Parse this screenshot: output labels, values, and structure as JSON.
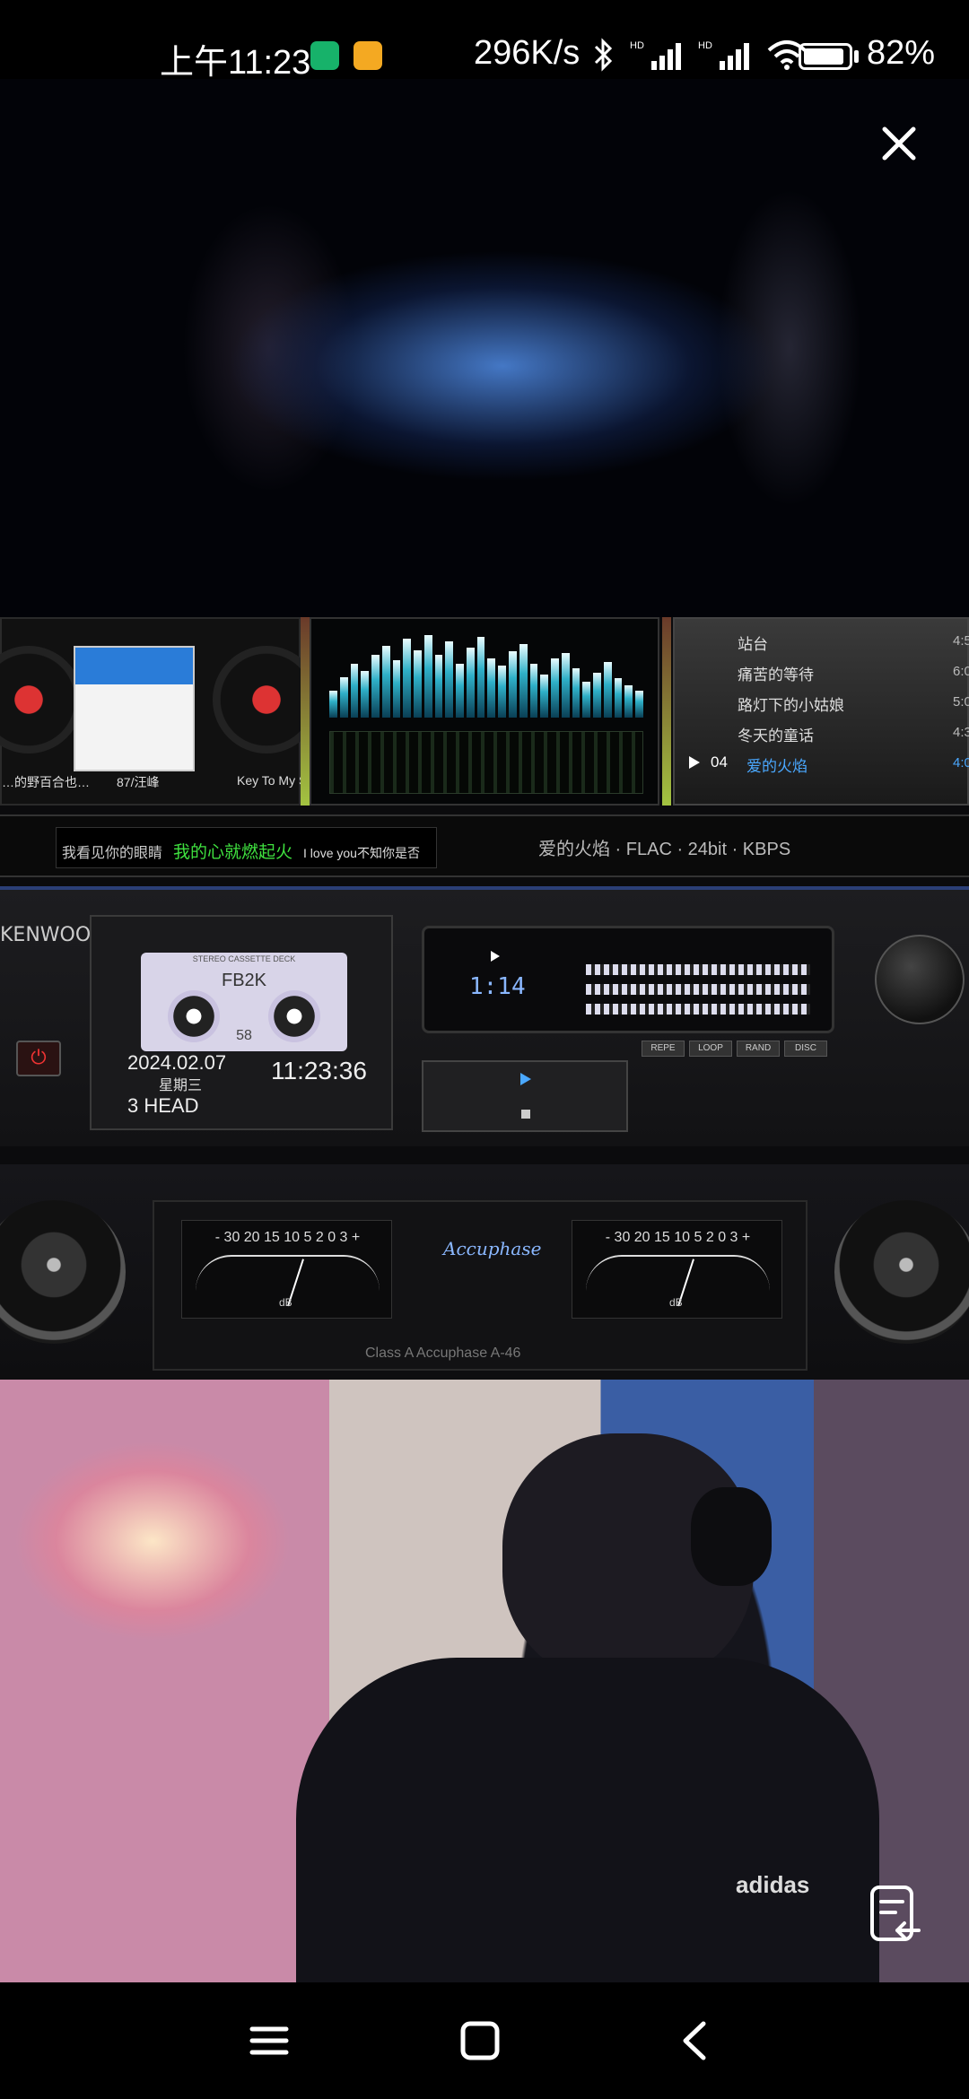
{
  "status_bar": {
    "time": "上午11:23",
    "network_speed": "296K/s",
    "battery_percent": "82%",
    "icons": [
      "bluetooth-icon",
      "hd-signal-icon",
      "hd-signal-icon",
      "wifi-icon",
      "battery-icon"
    ]
  },
  "overlay": {
    "close_icon": "close-icon"
  },
  "player": {
    "albums": [
      {
        "label": "…的野百合也…"
      },
      {
        "label": "87/汪峰"
      },
      {
        "label": "Key To My S"
      }
    ],
    "playlist": [
      {
        "title": "站台",
        "duration": "4:5"
      },
      {
        "title": "痛苦的等待",
        "duration": "6:0"
      },
      {
        "title": "路灯下的小姑娘",
        "duration": "5:0"
      },
      {
        "title": "冬天的童话",
        "duration": "4:3"
      },
      {
        "num": "04",
        "title": "爱的火焰",
        "duration": "4:0"
      }
    ],
    "lyrics": {
      "line1": "我看见你的眼睛",
      "line2": "我的心就燃起火",
      "line3": "I love you不知你是否"
    },
    "track_info": "爱的火焰 · FLAC · 24bit · KBPS",
    "deck": {
      "brand": "KENWOOD",
      "cassette_label": "STEREO CASSETTE DECK",
      "cassette_title": "FB2K",
      "cassette_sub": "58",
      "date": "2024.02.07",
      "weekday": "星期三",
      "time": "11:23:36",
      "head": "3 HEAD",
      "counter": "1:14",
      "mode_buttons": [
        "REPE",
        "LOOP",
        "RAND",
        "DISC"
      ]
    },
    "vu": {
      "brand": "Accuphase",
      "scale": "- 30 20 15 10 5 2 0 3 +",
      "unit": "dB",
      "footer": "Class A  Accuphase A-46"
    }
  },
  "webcam": {
    "shirt_logo": "adidas"
  },
  "floating_button_icon": "note-return-icon",
  "nav_bar": {
    "menu_icon": "menu-icon",
    "home_icon": "home-icon",
    "back_icon": "back-icon"
  }
}
